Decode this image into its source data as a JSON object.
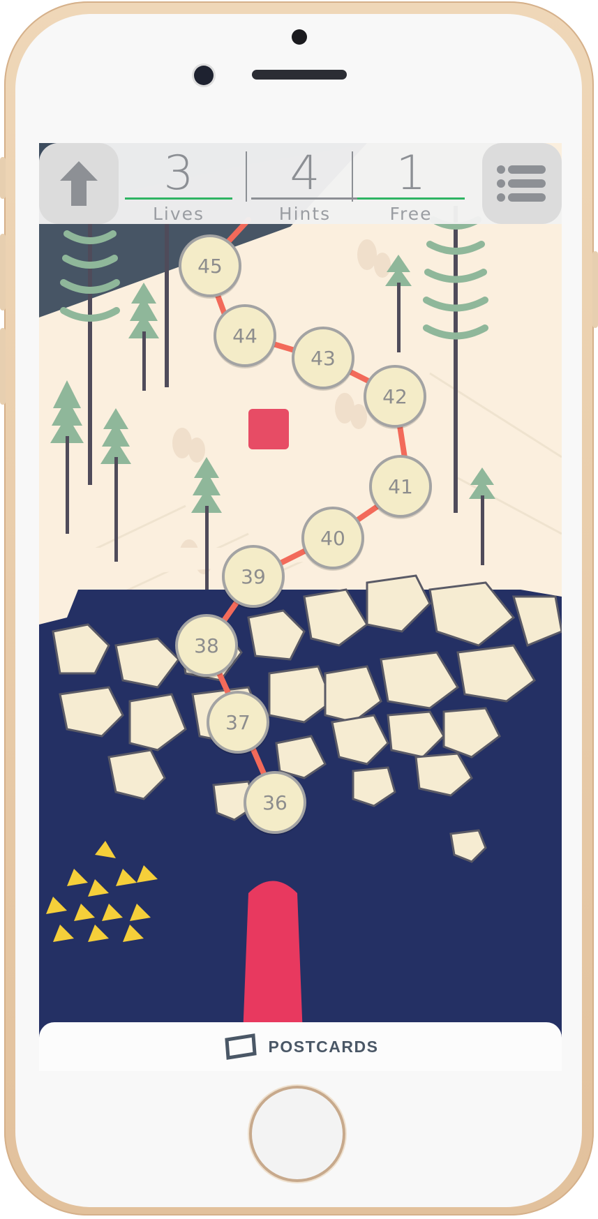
{
  "hud": {
    "stats": [
      {
        "value": "3",
        "label": "Lives",
        "bar_color": "#2fb463"
      },
      {
        "value": "4",
        "label": "Hints",
        "bar_color": "#8c8f94"
      },
      {
        "value": "1",
        "label": "Free",
        "bar_color": "#2fb463"
      }
    ],
    "back_icon": "up-arrow-icon",
    "menu_icon": "list-menu-icon"
  },
  "map": {
    "levels": [
      {
        "number": "45"
      },
      {
        "number": "44"
      },
      {
        "number": "43"
      },
      {
        "number": "42"
      },
      {
        "number": "41"
      },
      {
        "number": "40"
      },
      {
        "number": "39"
      },
      {
        "number": "38"
      },
      {
        "number": "37"
      },
      {
        "number": "36"
      }
    ],
    "colors": {
      "path": "#f26a5a",
      "water": "#243064",
      "snow": "#fbefde",
      "ice": "#f6ecd2",
      "tree": "#8fb79a",
      "trunk": "#4f4b5a",
      "marker": "#e8395f",
      "triangles": "#f5cf3a"
    }
  },
  "bottom": {
    "icon": "postcard-icon",
    "label": "POSTCARDS"
  }
}
